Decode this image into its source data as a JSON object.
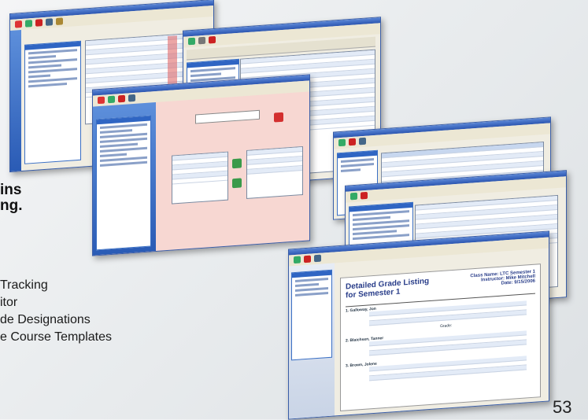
{
  "headline": {
    "line1": "ins",
    "line2": "ng."
  },
  "features": [
    {
      "label": "Tracking"
    },
    {
      "label": "itor"
    },
    {
      "label": "de Designations"
    },
    {
      "label": "e Course Templates"
    }
  ],
  "page_number": "53",
  "screens": {
    "final_doc": {
      "title": "Detailed Grade Listing",
      "subtitle": "for Semester 1",
      "class_name": "Class Name: LTC Semester 1",
      "instructor": "Instructor: Mike Mitchell",
      "date": "Date: 9/15/2006",
      "students": [
        "1. Galloway, Jon",
        "2. Blaichsen, Tanner",
        "3. Brown, Jolene"
      ],
      "grade_label": "Grade:"
    }
  },
  "colors": {
    "accent": "#2f65c3",
    "title_bar": "#2b55b0",
    "panel_bg": "#f0ede2"
  }
}
